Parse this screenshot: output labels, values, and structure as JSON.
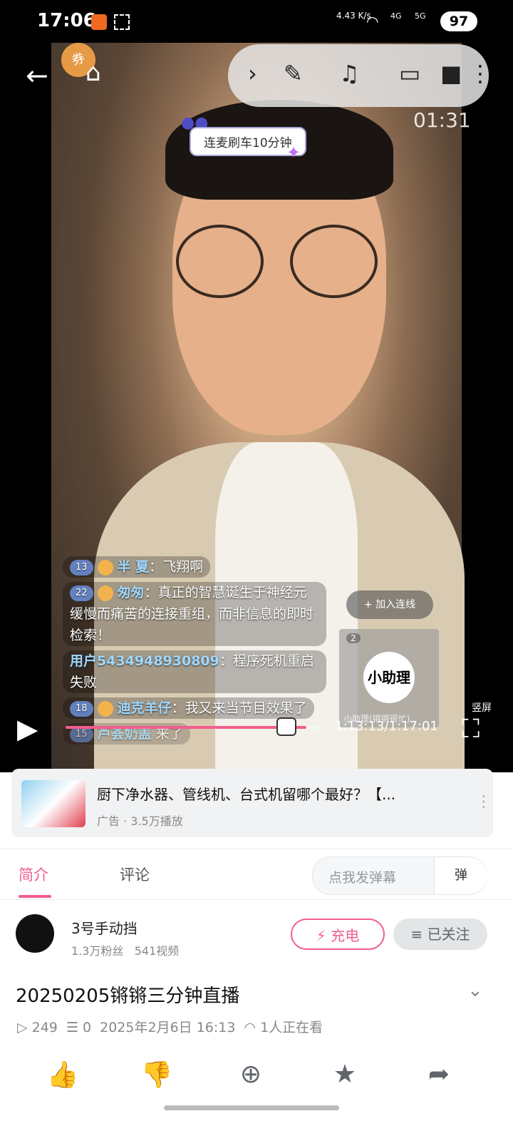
{
  "status_bar": {
    "time": "17:06",
    "net_speed": "4.43 K/s",
    "signal_4g": "4G",
    "signal_5g": "5G",
    "battery": "97"
  },
  "player": {
    "coupon_label": "券",
    "elapsed_overlay": "01:31",
    "sticker_text": "连麦刷车10分钟",
    "join_button": "加入连线",
    "assistant": {
      "count": "2",
      "logo_text": "小助理",
      "caption": "小助理(锵锵很忙)"
    },
    "chat": [
      {
        "level": "13",
        "name": "半 夏",
        "message": "飞翔啊"
      },
      {
        "level": "22",
        "name": "匆匆",
        "message": "真正的智慧诞生于神经元缓慢而痛苦的连接重组，而非信息的即时检索！"
      },
      {
        "level": "",
        "name": "用户5434948930809",
        "message": "程序死机重启失败"
      },
      {
        "level": "18",
        "name": "迪克羊仔",
        "message": "我又来当节目效果了"
      },
      {
        "level": "15",
        "name": "芦荟奶盖",
        "message": "来了"
      }
    ],
    "time_label": "1:13:13/1:17:01",
    "progress_fraction": 0.95,
    "vertical_label": "竖屏"
  },
  "ad": {
    "title": "厨下净水器、管线机、台式机留哪个最好？【...",
    "subtitle": "广告 · 3.5万播放"
  },
  "tabs": {
    "intro": "简介",
    "comments": "评论",
    "danmaku_placeholder": "点我发弹幕",
    "danmaku_button": "弹"
  },
  "uploader": {
    "name": "3号手动挡",
    "followers": "1.3万粉丝",
    "videos": "541视频",
    "charge_label": "充电",
    "follow_label": "已关注"
  },
  "video": {
    "title": "20250205锵锵三分钟直播",
    "plays": "249",
    "danmaku_count": "0",
    "date": "2025年2月6日 16:13",
    "watching": "1人正在看"
  },
  "colors": {
    "accent": "#f25d8e"
  }
}
